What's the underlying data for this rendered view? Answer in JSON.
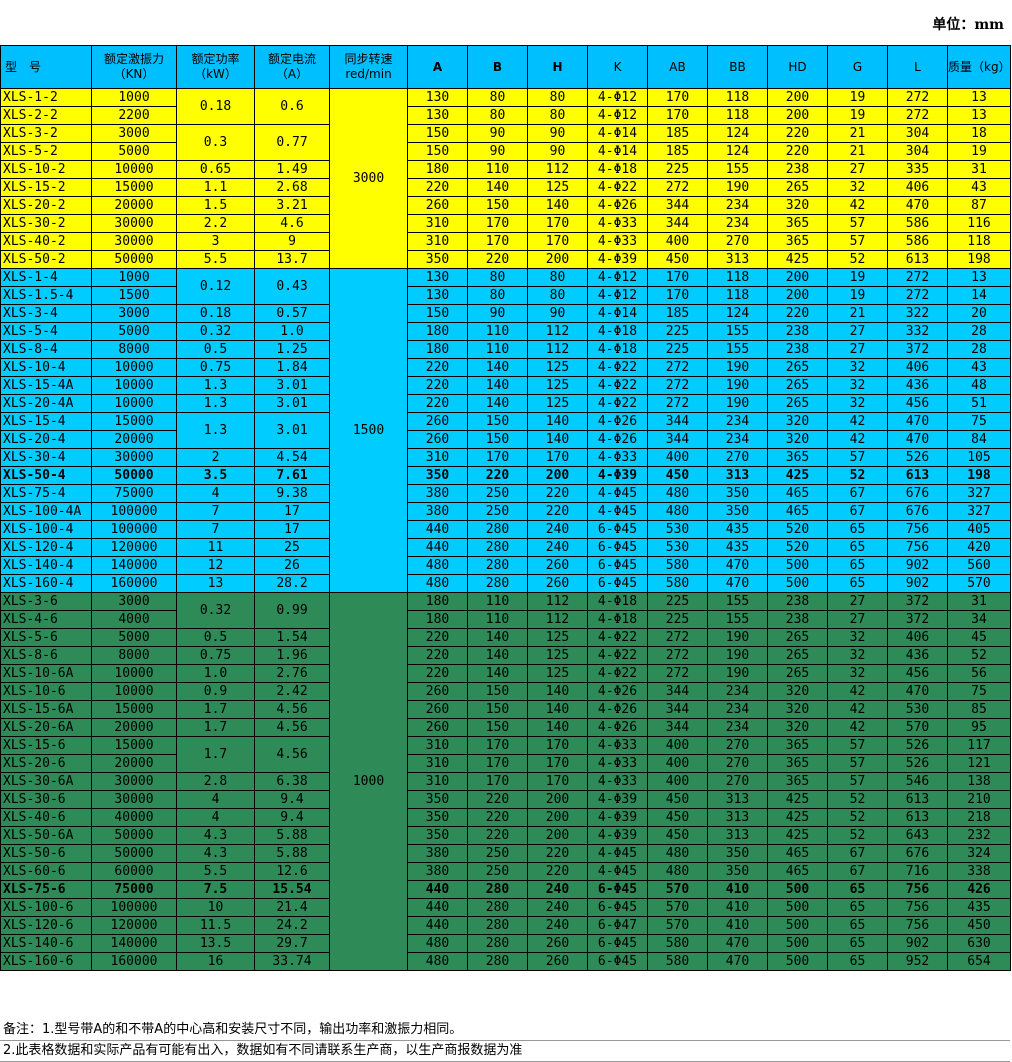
{
  "unit_label": "单位：mm",
  "headers": [
    "型　号",
    "额定激振力（KN）",
    "额定功率（kW）",
    "额定电流（A）",
    "同步转速 red/min",
    "A",
    "B",
    "H",
    "K",
    "AB",
    "BB",
    "HD",
    "G",
    "L",
    "质量（kg）"
  ],
  "speeds": [
    "3000",
    "1500",
    "1000"
  ],
  "rows": [
    [
      "XLS-1-2",
      "1000",
      "0.18",
      "0.6",
      "130",
      "80",
      "80",
      "4-Φ12",
      "170",
      "118",
      "200",
      "19",
      "272",
      "13"
    ],
    [
      "XLS-2-2",
      "2200",
      "",
      "",
      "130",
      "80",
      "80",
      "4-Φ12",
      "170",
      "118",
      "200",
      "19",
      "272",
      "13"
    ],
    [
      "XLS-3-2",
      "3000",
      "0.3",
      "0.77",
      "150",
      "90",
      "90",
      "4-Φ14",
      "185",
      "124",
      "220",
      "21",
      "304",
      "18"
    ],
    [
      "XLS-5-2",
      "5000",
      "",
      "",
      "150",
      "90",
      "90",
      "4-Φ14",
      "185",
      "124",
      "220",
      "21",
      "304",
      "19"
    ],
    [
      "XLS-10-2",
      "10000",
      "0.65",
      "1.49",
      "180",
      "110",
      "112",
      "4-Φ18",
      "225",
      "155",
      "238",
      "27",
      "335",
      "31"
    ],
    [
      "XLS-15-2",
      "15000",
      "1.1",
      "2.68",
      "220",
      "140",
      "125",
      "4-Φ22",
      "272",
      "190",
      "265",
      "32",
      "406",
      "43"
    ],
    [
      "XLS-20-2",
      "20000",
      "1.5",
      "3.21",
      "260",
      "150",
      "140",
      "4-Φ26",
      "344",
      "234",
      "320",
      "42",
      "470",
      "87"
    ],
    [
      "XLS-30-2",
      "30000",
      "2.2",
      "4.6",
      "310",
      "170",
      "170",
      "4-Φ33",
      "344",
      "234",
      "365",
      "57",
      "586",
      "116"
    ],
    [
      "XLS-40-2",
      "30000",
      "3",
      "9",
      "310",
      "170",
      "170",
      "4-Φ33",
      "400",
      "270",
      "365",
      "57",
      "586",
      "118"
    ],
    [
      "XLS-50-2",
      "50000",
      "5.5",
      "13.7",
      "350",
      "220",
      "200",
      "4-Φ39",
      "450",
      "313",
      "425",
      "52",
      "613",
      "198"
    ],
    [
      "XLS-1-4",
      "1000",
      "0.12",
      "0.43",
      "130",
      "80",
      "80",
      "4-Φ12",
      "170",
      "118",
      "200",
      "19",
      "272",
      "13"
    ],
    [
      "XLS-1.5-4",
      "1500",
      "",
      "",
      "130",
      "80",
      "80",
      "4-Φ12",
      "170",
      "118",
      "200",
      "19",
      "272",
      "14"
    ],
    [
      "XLS-3-4",
      "3000",
      "0.18",
      "0.57",
      "150",
      "90",
      "90",
      "4-Φ14",
      "185",
      "124",
      "220",
      "21",
      "322",
      "20"
    ],
    [
      "XLS-5-4",
      "5000",
      "0.32",
      "1.0",
      "180",
      "110",
      "112",
      "4-Φ18",
      "225",
      "155",
      "238",
      "27",
      "332",
      "28"
    ],
    [
      "XLS-8-4",
      "8000",
      "0.5",
      "1.25",
      "180",
      "110",
      "112",
      "4-Φ18",
      "225",
      "155",
      "238",
      "27",
      "372",
      "28"
    ],
    [
      "XLS-10-4",
      "10000",
      "0.75",
      "1.84",
      "220",
      "140",
      "125",
      "4-Φ22",
      "272",
      "190",
      "265",
      "32",
      "406",
      "43"
    ],
    [
      "XLS-15-4A",
      "10000",
      "1.3",
      "3.01",
      "220",
      "140",
      "125",
      "4-Φ22",
      "272",
      "190",
      "265",
      "32",
      "436",
      "48"
    ],
    [
      "XLS-20-4A",
      "10000",
      "1.3",
      "3.01",
      "220",
      "140",
      "125",
      "4-Φ22",
      "272",
      "190",
      "265",
      "32",
      "456",
      "51"
    ],
    [
      "XLS-15-4",
      "15000",
      "1.3",
      "3.01",
      "260",
      "150",
      "140",
      "4-Φ26",
      "344",
      "234",
      "320",
      "42",
      "470",
      "75"
    ],
    [
      "XLS-20-4",
      "20000",
      "",
      "",
      "260",
      "150",
      "140",
      "4-Φ26",
      "344",
      "234",
      "320",
      "42",
      "470",
      "84"
    ],
    [
      "XLS-30-4",
      "30000",
      "2",
      "4.54",
      "310",
      "170",
      "170",
      "4-Φ33",
      "400",
      "270",
      "365",
      "57",
      "526",
      "105"
    ],
    [
      "XLS-50-4",
      "50000",
      "3.5",
      "7.61",
      "350",
      "220",
      "200",
      "4-Φ39",
      "450",
      "313",
      "425",
      "52",
      "613",
      "198"
    ],
    [
      "XLS-75-4",
      "75000",
      "4",
      "9.38",
      "380",
      "250",
      "220",
      "4-Φ45",
      "480",
      "350",
      "465",
      "67",
      "676",
      "327"
    ],
    [
      "XLS-100-4A",
      "100000",
      "7",
      "17",
      "380",
      "250",
      "220",
      "4-Φ45",
      "480",
      "350",
      "465",
      "67",
      "676",
      "327"
    ],
    [
      "XLS-100-4",
      "100000",
      "7",
      "17",
      "440",
      "280",
      "240",
      "6-Φ45",
      "530",
      "435",
      "520",
      "65",
      "756",
      "405"
    ],
    [
      "XLS-120-4",
      "120000",
      "11",
      "25",
      "440",
      "280",
      "240",
      "6-Φ45",
      "530",
      "435",
      "520",
      "65",
      "756",
      "420"
    ],
    [
      "XLS-140-4",
      "140000",
      "12",
      "26",
      "480",
      "280",
      "260",
      "6-Φ45",
      "580",
      "470",
      "500",
      "65",
      "902",
      "560"
    ],
    [
      "XLS-160-4",
      "160000",
      "13",
      "28.2",
      "480",
      "280",
      "260",
      "6-Φ45",
      "580",
      "470",
      "500",
      "65",
      "902",
      "570"
    ],
    [
      "XLS-3-6",
      "3000",
      "0.32",
      "0.99",
      "180",
      "110",
      "112",
      "4-Φ18",
      "225",
      "155",
      "238",
      "27",
      "372",
      "31"
    ],
    [
      "XLS-4-6",
      "4000",
      "",
      "",
      "180",
      "110",
      "112",
      "4-Φ18",
      "225",
      "155",
      "238",
      "27",
      "372",
      "34"
    ],
    [
      "XLS-5-6",
      "5000",
      "0.5",
      "1.54",
      "220",
      "140",
      "125",
      "4-Φ22",
      "272",
      "190",
      "265",
      "32",
      "406",
      "45"
    ],
    [
      "XLS-8-6",
      "8000",
      "0.75",
      "1.96",
      "220",
      "140",
      "125",
      "4-Φ22",
      "272",
      "190",
      "265",
      "32",
      "436",
      "52"
    ],
    [
      "XLS-10-6A",
      "10000",
      "1.0",
      "2.76",
      "220",
      "140",
      "125",
      "4-Φ22",
      "272",
      "190",
      "265",
      "32",
      "456",
      "56"
    ],
    [
      "XLS-10-6",
      "10000",
      "0.9",
      "2.42",
      "260",
      "150",
      "140",
      "4-Φ26",
      "344",
      "234",
      "320",
      "42",
      "470",
      "75"
    ],
    [
      "XLS-15-6A",
      "15000",
      "1.7",
      "4.56",
      "260",
      "150",
      "140",
      "4-Φ26",
      "344",
      "234",
      "320",
      "42",
      "530",
      "85"
    ],
    [
      "XLS-20-6A",
      "20000",
      "1.7",
      "4.56",
      "260",
      "150",
      "140",
      "4-Φ26",
      "344",
      "234",
      "320",
      "42",
      "570",
      "95"
    ],
    [
      "XLS-15-6",
      "15000",
      "1.7",
      "4.56",
      "310",
      "170",
      "170",
      "4-Φ33",
      "400",
      "270",
      "365",
      "57",
      "526",
      "117"
    ],
    [
      "XLS-20-6",
      "20000",
      "",
      "",
      "310",
      "170",
      "170",
      "4-Φ33",
      "400",
      "270",
      "365",
      "57",
      "526",
      "121"
    ],
    [
      "XLS-30-6A",
      "30000",
      "2.8",
      "6.38",
      "310",
      "170",
      "170",
      "4-Φ33",
      "400",
      "270",
      "365",
      "57",
      "546",
      "138"
    ],
    [
      "XLS-30-6",
      "30000",
      "4",
      "9.4",
      "350",
      "220",
      "200",
      "4-Φ39",
      "450",
      "313",
      "425",
      "52",
      "613",
      "210"
    ],
    [
      "XLS-40-6",
      "40000",
      "4",
      "9.4",
      "350",
      "220",
      "200",
      "4-Φ39",
      "450",
      "313",
      "425",
      "52",
      "613",
      "218"
    ],
    [
      "XLS-50-6A",
      "50000",
      "4.3",
      "5.88",
      "350",
      "220",
      "200",
      "4-Φ39",
      "450",
      "313",
      "425",
      "52",
      "643",
      "232"
    ],
    [
      "XLS-50-6",
      "50000",
      "4.3",
      "5.88",
      "380",
      "250",
      "220",
      "4-Φ45",
      "480",
      "350",
      "465",
      "67",
      "676",
      "324"
    ],
    [
      "XLS-60-6",
      "60000",
      "5.5",
      "12.6",
      "380",
      "250",
      "220",
      "4-Φ45",
      "480",
      "350",
      "465",
      "67",
      "716",
      "338"
    ],
    [
      "XLS-75-6",
      "75000",
      "7.5",
      "15.54",
      "440",
      "280",
      "240",
      "6-Φ45",
      "570",
      "410",
      "500",
      "65",
      "756",
      "426"
    ],
    [
      "XLS-100-6",
      "100000",
      "10",
      "21.4",
      "440",
      "280",
      "240",
      "6-Φ45",
      "570",
      "410",
      "500",
      "65",
      "756",
      "435"
    ],
    [
      "XLS-120-6",
      "120000",
      "11.5",
      "24.2",
      "440",
      "280",
      "240",
      "6-Φ47",
      "570",
      "410",
      "500",
      "65",
      "756",
      "450"
    ],
    [
      "XLS-140-6",
      "140000",
      "13.5",
      "29.7",
      "480",
      "280",
      "260",
      "6-Φ45",
      "580",
      "470",
      "500",
      "65",
      "902",
      "630"
    ],
    [
      "XLS-160-6",
      "160000",
      "16",
      "33.74",
      "480",
      "280",
      "260",
      "6-Φ45",
      "580",
      "470",
      "500",
      "65",
      "952",
      "654"
    ]
  ],
  "notes": [
    "备注：1.型号带A的和不带A的中心高和安装尺寸不同，输出功率和激振力相同。",
    "2.此表格数据和实际产品有可能有出入，数据如有不同请联系生产商，以生产商报数据为准"
  ],
  "colors": {
    "header": "#00bfff",
    "group_3000": "#ffff00",
    "group_1500": "#00ccff",
    "group_1000": "#2e8b57"
  }
}
